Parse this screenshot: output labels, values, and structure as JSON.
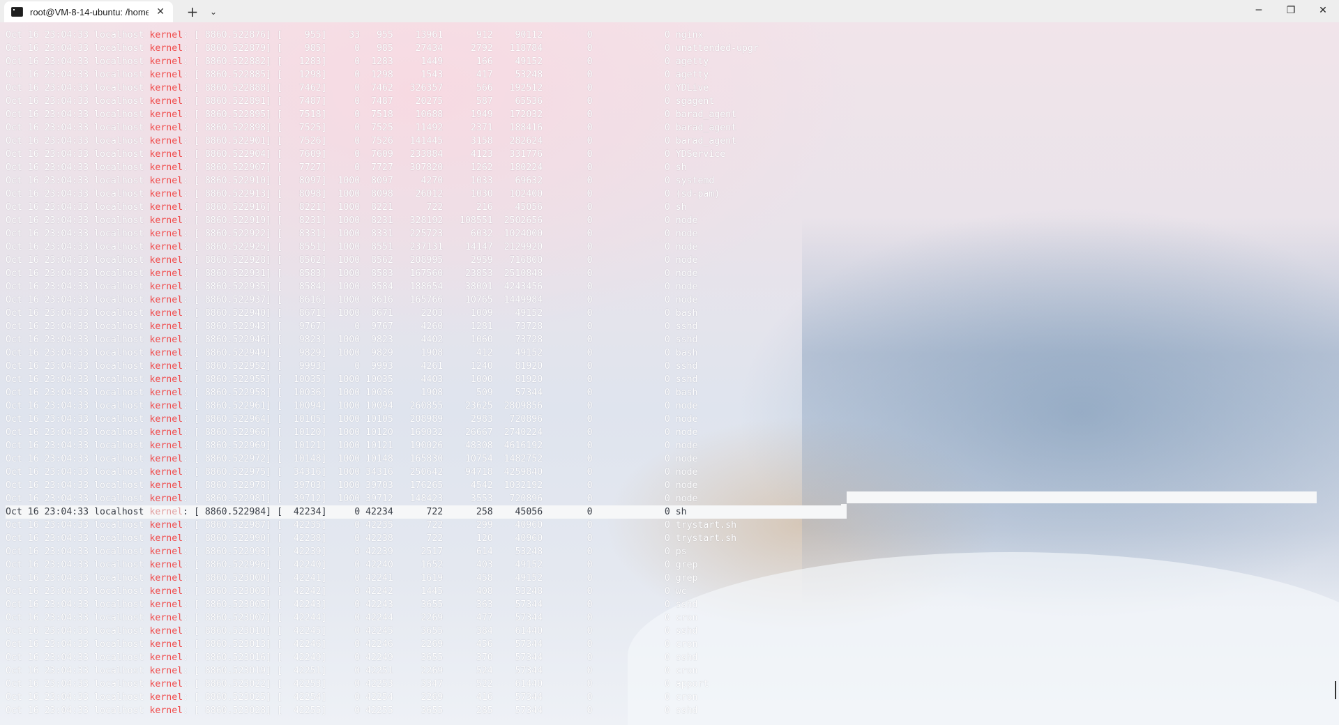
{
  "window": {
    "tab_title": "root@VM-8-14-ubuntu: /home",
    "tab_close": "✕",
    "new_tab": "+",
    "tab_dropdown": "⌄",
    "minimize": "─",
    "maximize": "❐",
    "close": "✕"
  },
  "terminal": {
    "prefix": "Oct 16 23:04:33 localhost ",
    "keyword": "kernel",
    "rows": [
      ": [ 8860.522876] [    955]    33   955    13961      912    90112        0             0 nginx",
      ": [ 8860.522879] [    985]     0   985    27434     2792   118784        0             0 unattended-upgr",
      ": [ 8860.522882] [   1283]     0  1283     1449      166    49152        0             0 agetty",
      ": [ 8860.522885] [   1298]     0  1298     1543      417    53248        0             0 agetty",
      ": [ 8860.522888] [   7462]     0  7462   326357      566   192512        0             0 YDLive",
      ": [ 8860.522891] [   7487]     0  7487    20275      587    65536        0             0 sgagent",
      ": [ 8860.522895] [   7518]     0  7518    10688     1949   172032        0             0 barad_agent",
      ": [ 8860.522898] [   7525]     0  7525    11492     2371   188416        0             0 barad_agent",
      ": [ 8860.522901] [   7526]     0  7526   141445     3158   282624        0             0 barad_agent",
      ": [ 8860.522904] [   7609]     0  7609   233884     4123   331776        0             0 YDService",
      ": [ 8860.522907] [   7727]     0  7727   307820     1262   180224        0             0 sh",
      ": [ 8860.522910] [   8097]  1000  8097     4270     1033    69632        0             0 systemd",
      ": [ 8860.522913] [   8098]  1000  8098    26012     1030   102400        0             0 (sd-pam)",
      ": [ 8860.522916] [   8221]  1000  8221      722      216    45056        0             0 sh",
      ": [ 8860.522919] [   8231]  1000  8231   328192   108551  2502656        0             0 node",
      ": [ 8860.522922] [   8331]  1000  8331   225723     6032  1024000        0             0 node",
      ": [ 8860.522925] [   8551]  1000  8551   237131    14147  2129920        0             0 node",
      ": [ 8860.522928] [   8562]  1000  8562   208995     2959   716800        0             0 node",
      ": [ 8860.522931] [   8583]  1000  8583   167560    23853  2510848        0             0 node",
      ": [ 8860.522935] [   8584]  1000  8584   188654    38001  4243456        0             0 node",
      ": [ 8860.522937] [   8616]  1000  8616   165766    10765  1449984        0             0 node",
      ": [ 8860.522940] [   8671]  1000  8671     2203     1009    49152        0             0 bash",
      ": [ 8860.522943] [   9767]     0  9767     4260     1281    73728        0             0 sshd",
      ": [ 8860.522946] [   9823]  1000  9823     4402     1060    73728        0             0 sshd",
      ": [ 8860.522949] [   9829]  1000  9829     1908      412    49152        0             0 bash",
      ": [ 8860.522952] [   9993]     0  9993     4261     1240    81920        0             0 sshd",
      ": [ 8860.522955] [  10035]  1000 10035     4403     1000    81920        0             0 sshd",
      ": [ 8860.522958] [  10036]  1000 10036     1908      509    57344        0             0 bash",
      ": [ 8860.522961] [  10094]  1000 10094   260855    23625  2809856        0             0 node",
      ": [ 8860.522964] [  10105]  1000 10105   208989     2983   720896        0             0 node",
      ": [ 8860.522966] [  10120]  1000 10120   169032    26667  2740224        0             0 node",
      ": [ 8860.522969] [  10121]  1000 10121   190026    48308  4616192        0             0 node",
      ": [ 8860.522972] [  10148]  1000 10148   165830    10754  1482752        0             0 node",
      ": [ 8860.522975] [  34316]  1000 34316   250642    94718  4259840        0             0 node",
      ": [ 8860.522978] [  39703]  1000 39703   176265     4542  1032192        0             0 node",
      ": [ 8860.522981] [  39712]  1000 39712   148423     3553   720896        0             0 node",
      ": [ 8860.522984] [  42234]     0 42234      722      258    45056        0             0 sh",
      ": [ 8860.522987] [  42235]     0 42235      722      299    40960        0             0 trystart.sh",
      ": [ 8860.522990] [  42238]     0 42238      722      120    40960        0             0 trystart.sh",
      ": [ 8860.522993] [  42239]     0 42239     2517      614    53248        0             0 ps",
      ": [ 8860.522996] [  42240]     0 42240     1652      403    49152        0             0 grep",
      ": [ 8860.523000] [  42241]     0 42241     1619      458    49152        0             0 grep",
      ": [ 8860.523003] [  42242]     0 42242     1445      408    53248        0             0 wc",
      ": [ 8860.523005] [  42243]     0 42243     3655      363    57344        0             0 sshd",
      ": [ 8860.523007] [  42244]     0 42244     2269      477    57344        0             0 cron",
      ": [ 8860.523010] [  42245]     0 42245     3655      384    61440        0             0 sshd",
      ": [ 8860.523013] [  42246]     0 42246     2269      456    57344        0             0 cron",
      ": [ 8860.523016] [  42249]     0 42249     3655      370    57344        0             0 sshd",
      ": [ 8860.523019] [  42251]     0 42251     2269      524    57344        0             0 cron",
      ": [ 8860.523022] [  42253]     0 42253     3347      522    61440        0             0 apport",
      ": [ 8860.523025] [  42254]     0 42254     2269      416    57344        0             0 cron",
      ": [ 8860.523028] [  42255]     0 42255     3655      285    57344        0             0 sshd"
    ]
  }
}
